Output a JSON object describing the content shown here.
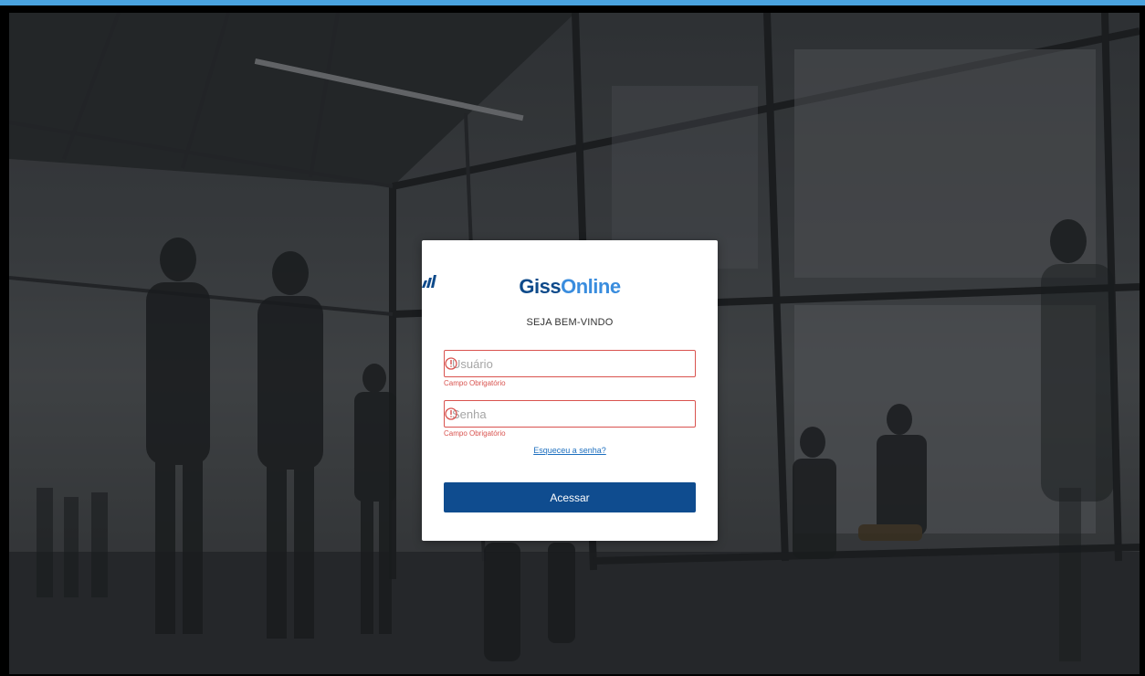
{
  "brand": {
    "logo_prefix": "Giss",
    "logo_suffix": "Online",
    "primary_color": "#0e4a8a",
    "secondary_color": "#3a8dde",
    "logo_icon": "bars-logo-icon"
  },
  "login": {
    "welcome": "SEJA BEM-VINDO",
    "username": {
      "placeholder": "Usuário",
      "value": "",
      "error": "Campo Obrigatório",
      "status_icon": "warning-icon"
    },
    "password": {
      "placeholder": "Senha",
      "value": "",
      "error": "Campo Obrigatório",
      "status_icon": "warning-icon"
    },
    "forgot_label": "Esqueceu a senha?",
    "submit_label": "Acessar",
    "button_color": "#0f4c8f",
    "error_color": "#d9534f"
  }
}
